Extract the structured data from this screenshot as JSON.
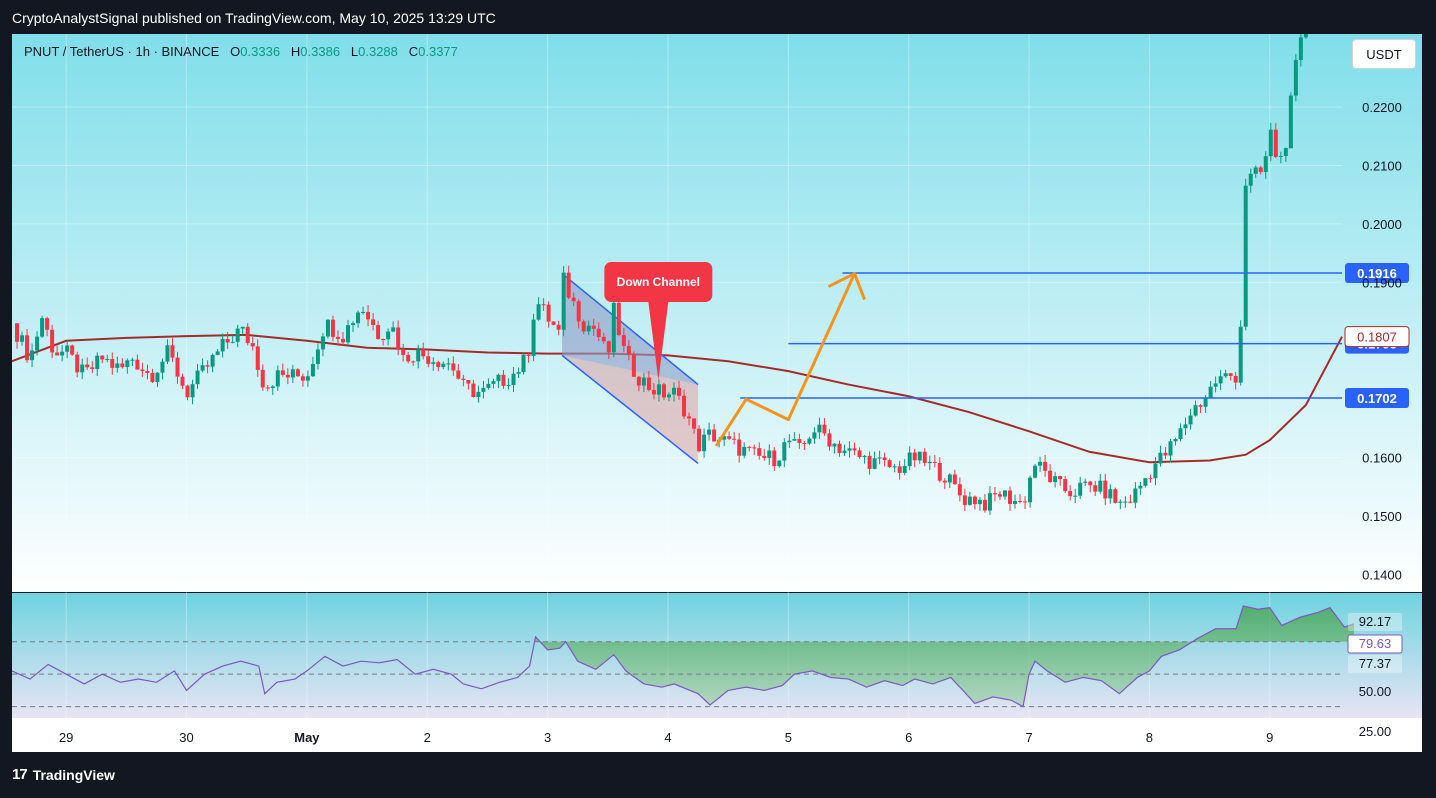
{
  "header": {
    "published_text": "CryptoAnalystSignal published on TradingView.com, May 10, 2025 13:29 UTC"
  },
  "symbol": {
    "name": "PNUT / TetherUS · 1h · BINANCE",
    "o_label": "O",
    "o": "0.3336",
    "h_label": "H",
    "h": "0.3386",
    "l_label": "L",
    "l": "0.3288",
    "c_label": "C",
    "c": "0.3377"
  },
  "currency_button": "USDT",
  "footer": {
    "logo": "17",
    "brand": "TradingView"
  },
  "colors": {
    "up": "#089981",
    "down": "#f23645",
    "ma": "#a52a2a",
    "level": "#2962ff",
    "arrow": "#f7931a",
    "rsi": "#7e57c2",
    "label_red": "#f23645"
  },
  "chart_data": {
    "type": "candlestick",
    "price_axis": {
      "ticks": [
        "0.2200",
        "0.2100",
        "0.2000",
        "0.1900",
        "0.1600",
        "0.1500",
        "0.1400"
      ],
      "tick_values": [
        0.22,
        0.21,
        0.2,
        0.19,
        0.16,
        0.15,
        0.14
      ],
      "range": [
        0.137,
        0.2325
      ]
    },
    "time_axis": {
      "labels": [
        "29",
        "30",
        "May",
        "2",
        "3",
        "4",
        "5",
        "6",
        "7",
        "8",
        "9"
      ],
      "day_index": [
        0,
        1,
        2,
        3,
        4,
        5,
        6,
        7,
        8,
        9,
        10
      ]
    },
    "x_range_days": [
      -0.45,
      10.6
    ],
    "ohlc_points": [
      [
        -0.45,
        0.183
      ],
      [
        -0.3,
        0.177
      ],
      [
        -0.2,
        0.184
      ],
      [
        -0.1,
        0.178
      ],
      [
        0.0,
        0.178
      ],
      [
        0.15,
        0.174
      ],
      [
        0.3,
        0.177
      ],
      [
        0.45,
        0.175
      ],
      [
        0.55,
        0.177
      ],
      [
        0.7,
        0.174
      ],
      [
        0.85,
        0.178
      ],
      [
        1.0,
        0.171
      ],
      [
        1.15,
        0.175
      ],
      [
        1.3,
        0.179
      ],
      [
        1.45,
        0.182
      ],
      [
        1.55,
        0.179
      ],
      [
        1.65,
        0.172
      ],
      [
        1.75,
        0.174
      ],
      [
        1.9,
        0.174
      ],
      [
        2.0,
        0.174
      ],
      [
        2.05,
        0.177
      ],
      [
        2.15,
        0.183
      ],
      [
        2.3,
        0.181
      ],
      [
        2.45,
        0.186
      ],
      [
        2.6,
        0.181
      ],
      [
        2.7,
        0.183
      ],
      [
        2.8,
        0.177
      ],
      [
        2.9,
        0.178
      ],
      [
        3.05,
        0.177
      ],
      [
        3.2,
        0.176
      ],
      [
        3.3,
        0.172
      ],
      [
        3.45,
        0.171
      ],
      [
        3.6,
        0.173
      ],
      [
        3.7,
        0.174
      ],
      [
        3.83,
        0.177
      ],
      [
        3.9,
        0.187
      ],
      [
        4.0,
        0.184
      ],
      [
        4.1,
        0.181
      ],
      [
        4.12,
        0.191
      ],
      [
        4.2,
        0.187
      ],
      [
        4.3,
        0.183
      ],
      [
        4.4,
        0.182
      ],
      [
        4.5,
        0.177
      ],
      [
        4.55,
        0.185
      ],
      [
        4.65,
        0.177
      ],
      [
        4.75,
        0.174
      ],
      [
        4.85,
        0.172
      ],
      [
        4.95,
        0.171
      ],
      [
        5.05,
        0.171
      ],
      [
        5.15,
        0.168
      ],
      [
        5.25,
        0.162
      ],
      [
        5.35,
        0.164
      ],
      [
        5.45,
        0.163
      ],
      [
        5.55,
        0.162
      ],
      [
        5.65,
        0.161
      ],
      [
        5.75,
        0.16
      ],
      [
        5.9,
        0.16
      ],
      [
        6.0,
        0.163
      ],
      [
        6.1,
        0.161
      ],
      [
        6.2,
        0.165
      ],
      [
        6.3,
        0.164
      ],
      [
        6.4,
        0.162
      ],
      [
        6.5,
        0.161
      ],
      [
        6.6,
        0.16
      ],
      [
        6.75,
        0.159
      ],
      [
        6.9,
        0.158
      ],
      [
        7.05,
        0.16
      ],
      [
        7.15,
        0.159
      ],
      [
        7.3,
        0.157
      ],
      [
        7.45,
        0.153
      ],
      [
        7.55,
        0.153
      ],
      [
        7.65,
        0.152
      ],
      [
        7.75,
        0.154
      ],
      [
        7.85,
        0.153
      ],
      [
        7.95,
        0.152
      ],
      [
        8.0,
        0.156
      ],
      [
        8.05,
        0.159
      ],
      [
        8.15,
        0.157
      ],
      [
        8.25,
        0.155
      ],
      [
        8.35,
        0.154
      ],
      [
        8.45,
        0.155
      ],
      [
        8.55,
        0.155
      ],
      [
        8.65,
        0.154
      ],
      [
        8.75,
        0.152
      ],
      [
        8.85,
        0.153
      ],
      [
        8.95,
        0.156
      ],
      [
        9.05,
        0.159
      ],
      [
        9.15,
        0.161
      ],
      [
        9.25,
        0.164
      ],
      [
        9.35,
        0.168
      ],
      [
        9.45,
        0.17
      ],
      [
        9.55,
        0.173
      ],
      [
        9.65,
        0.174
      ],
      [
        9.72,
        0.174
      ],
      [
        9.75,
        0.178
      ],
      [
        9.8,
        0.207
      ],
      [
        9.85,
        0.208
      ],
      [
        9.95,
        0.209
      ],
      [
        10.0,
        0.216
      ],
      [
        10.05,
        0.212
      ],
      [
        10.1,
        0.211
      ],
      [
        10.15,
        0.216
      ],
      [
        10.2,
        0.225
      ],
      [
        10.3,
        0.235
      ]
    ],
    "moving_average": [
      [
        -0.45,
        0.1765
      ],
      [
        0.0,
        0.18
      ],
      [
        0.5,
        0.1805
      ],
      [
        1.0,
        0.1808
      ],
      [
        1.5,
        0.181
      ],
      [
        2.0,
        0.18
      ],
      [
        2.5,
        0.1788
      ],
      [
        3.0,
        0.1785
      ],
      [
        3.5,
        0.178
      ],
      [
        4.0,
        0.1778
      ],
      [
        4.5,
        0.1778
      ],
      [
        5.0,
        0.1775
      ],
      [
        5.5,
        0.1765
      ],
      [
        6.0,
        0.1748
      ],
      [
        6.5,
        0.1725
      ],
      [
        7.0,
        0.1705
      ],
      [
        7.5,
        0.1678
      ],
      [
        8.0,
        0.1645
      ],
      [
        8.5,
        0.161
      ],
      [
        9.0,
        0.1592
      ],
      [
        9.5,
        0.1595
      ],
      [
        9.8,
        0.1605
      ],
      [
        10.0,
        0.163
      ],
      [
        10.3,
        0.169
      ],
      [
        10.6,
        0.1807
      ]
    ],
    "channel": {
      "label": "Down Channel",
      "upper": [
        [
          4.12,
          0.1915
        ],
        [
          5.25,
          0.1725
        ]
      ],
      "lower": [
        [
          4.12,
          0.1775
        ],
        [
          5.25,
          0.159
        ]
      ]
    },
    "projection_arrow": [
      [
        5.4,
        0.162
      ],
      [
        5.65,
        0.17
      ],
      [
        6.0,
        0.1665
      ],
      [
        6.55,
        0.1915
      ]
    ],
    "levels": [
      {
        "value": "0.1916",
        "start_day": 6.45
      },
      {
        "value": "0.1795",
        "start_day": 6.0
      },
      {
        "value": "0.1702",
        "start_day": 5.6
      }
    ],
    "ma_value_label": "0.1807",
    "rsi": {
      "labels": [
        "92.17",
        "79.63",
        "77.37",
        "50.00",
        "25.00"
      ],
      "levels": [
        70,
        50,
        30
      ],
      "range": [
        23,
        100
      ],
      "points": [
        [
          -0.45,
          52
        ],
        [
          -0.3,
          47
        ],
        [
          -0.15,
          56
        ],
        [
          0.0,
          50
        ],
        [
          0.15,
          44
        ],
        [
          0.3,
          50
        ],
        [
          0.45,
          45
        ],
        [
          0.6,
          47
        ],
        [
          0.75,
          45
        ],
        [
          0.9,
          52
        ],
        [
          1.0,
          40
        ],
        [
          1.15,
          50
        ],
        [
          1.3,
          55
        ],
        [
          1.45,
          58
        ],
        [
          1.6,
          55
        ],
        [
          1.65,
          38
        ],
        [
          1.75,
          45
        ],
        [
          1.9,
          47
        ],
        [
          2.0,
          52
        ],
        [
          2.15,
          61
        ],
        [
          2.3,
          55
        ],
        [
          2.45,
          58
        ],
        [
          2.6,
          57
        ],
        [
          2.75,
          59
        ],
        [
          2.9,
          50
        ],
        [
          3.05,
          53
        ],
        [
          3.2,
          50
        ],
        [
          3.3,
          44
        ],
        [
          3.45,
          41
        ],
        [
          3.6,
          45
        ],
        [
          3.75,
          48
        ],
        [
          3.85,
          55
        ],
        [
          3.9,
          73
        ],
        [
          4.0,
          65
        ],
        [
          4.1,
          66
        ],
        [
          4.15,
          70
        ],
        [
          4.25,
          58
        ],
        [
          4.4,
          53
        ],
        [
          4.55,
          62
        ],
        [
          4.65,
          52
        ],
        [
          4.8,
          44
        ],
        [
          4.95,
          42
        ],
        [
          5.05,
          44
        ],
        [
          5.15,
          41
        ],
        [
          5.25,
          38
        ],
        [
          5.35,
          31
        ],
        [
          5.5,
          40
        ],
        [
          5.65,
          42
        ],
        [
          5.8,
          40
        ],
        [
          5.95,
          43
        ],
        [
          6.05,
          50
        ],
        [
          6.2,
          52
        ],
        [
          6.35,
          48
        ],
        [
          6.5,
          47
        ],
        [
          6.65,
          42
        ],
        [
          6.8,
          46
        ],
        [
          6.95,
          43
        ],
        [
          7.05,
          47
        ],
        [
          7.2,
          44
        ],
        [
          7.35,
          48
        ],
        [
          7.45,
          40
        ],
        [
          7.55,
          32
        ],
        [
          7.7,
          36
        ],
        [
          7.85,
          34
        ],
        [
          7.95,
          30
        ],
        [
          8.0,
          50
        ],
        [
          8.05,
          58
        ],
        [
          8.15,
          52
        ],
        [
          8.3,
          45
        ],
        [
          8.45,
          48
        ],
        [
          8.6,
          46
        ],
        [
          8.75,
          38
        ],
        [
          8.9,
          48
        ],
        [
          9.0,
          52
        ],
        [
          9.1,
          61
        ],
        [
          9.25,
          65
        ],
        [
          9.4,
          72
        ],
        [
          9.55,
          78
        ],
        [
          9.72,
          78
        ],
        [
          9.78,
          92
        ],
        [
          9.9,
          90
        ],
        [
          10.0,
          91
        ],
        [
          10.1,
          80
        ],
        [
          10.25,
          85
        ],
        [
          10.4,
          88
        ],
        [
          10.5,
          91
        ],
        [
          10.62,
          79
        ],
        [
          10.7,
          81
        ]
      ]
    }
  }
}
